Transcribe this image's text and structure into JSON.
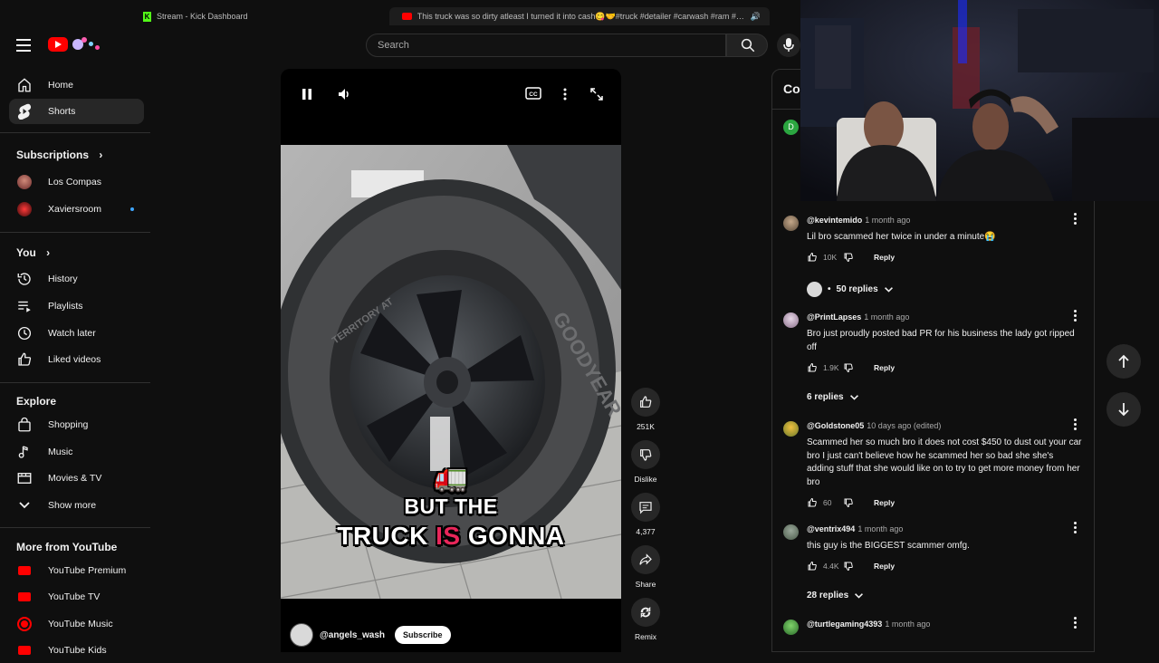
{
  "browser": {
    "tabs": [
      {
        "title": "Stream - Kick Dashboard"
      },
      {
        "title": "This truck was so dirty atleast I turned it into cash😋🤝#truck #detailer #carwash #ram #money..."
      }
    ]
  },
  "header": {
    "search_placeholder": "Search"
  },
  "sidebar": {
    "main": [
      {
        "label": "Home",
        "icon": "home-icon"
      },
      {
        "label": "Shorts",
        "icon": "shorts-icon",
        "active": true
      }
    ],
    "subscriptions_heading": "Subscriptions",
    "subscriptions": [
      {
        "label": "Los Compas"
      },
      {
        "label": "Xaviersroom",
        "new_content": true
      }
    ],
    "you_heading": "You",
    "you": [
      {
        "label": "History"
      },
      {
        "label": "Playlists"
      },
      {
        "label": "Watch later"
      },
      {
        "label": "Liked videos"
      }
    ],
    "explore_heading": "Explore",
    "explore": [
      {
        "label": "Shopping"
      },
      {
        "label": "Music"
      },
      {
        "label": "Movies & TV"
      },
      {
        "label": "Show more"
      }
    ],
    "more_heading": "More from YouTube",
    "more": [
      {
        "label": "YouTube Premium"
      },
      {
        "label": "YouTube TV"
      },
      {
        "label": "YouTube Music"
      },
      {
        "label": "YouTube Kids"
      }
    ]
  },
  "player": {
    "caption_line1": "BUT THE",
    "caption_line2_a": "TRUCK",
    "caption_line2_b": "IS",
    "caption_line2_c": "GONNA",
    "emoji": "🚛",
    "tire_brand": "GOODYEAR",
    "tire_model": "TERRITORY AT",
    "channel": "@angels_wash",
    "subscribe_label": "Subscribe"
  },
  "actions": {
    "likes": "251K",
    "dislike_label": "Dislike",
    "comments": "4,377",
    "share_label": "Share",
    "remix_label": "Remix"
  },
  "comments_panel": {
    "title": "Con",
    "pinned_avatar_letter": "D",
    "items": [
      {
        "user": "@kevintemido",
        "time": "1 month ago",
        "text": "Lil bro scammed her twice in under a minute😭",
        "likes": "10K",
        "replies": "50 replies",
        "reply_label": "Reply"
      },
      {
        "user": "@PrintLapses",
        "time": "1 month ago",
        "text": "Bro just proudly posted bad PR for his business the lady got ripped off",
        "likes": "1.9K",
        "replies": "6 replies",
        "reply_label": "Reply"
      },
      {
        "user": "@Goldstone05",
        "time": "10 days ago (edited)",
        "text": "Scammed her so much bro it does not cost $450 to dust out your car bro I just can't believe how he scammed her so bad she she's adding stuff that she would like on to try to get more money from her bro",
        "likes": "60",
        "reply_label": "Reply"
      },
      {
        "user": "@ventrix494",
        "time": "1 month ago",
        "text": "this guy is the BIGGEST scammer omfg.",
        "likes": "4.4K",
        "replies": "28 replies",
        "reply_label": "Reply"
      },
      {
        "user": "@turtlegaming4393",
        "time": "1 month ago"
      }
    ],
    "reply_dot": "•"
  },
  "colors": {
    "background": "#0f0f0f",
    "accent_red": "#ff0000",
    "caption_highlight": "#e8265a",
    "link_blue": "#3ea6ff"
  }
}
